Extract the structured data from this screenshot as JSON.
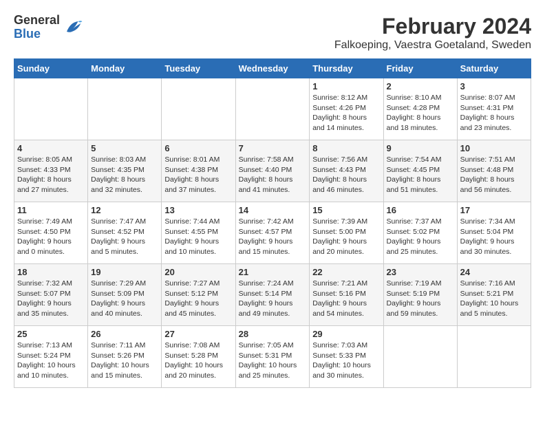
{
  "header": {
    "logo": {
      "line1": "General",
      "line2": "Blue"
    },
    "title": "February 2024",
    "subtitle": "Falkoeping, Vaestra Goetaland, Sweden"
  },
  "calendar": {
    "weekdays": [
      "Sunday",
      "Monday",
      "Tuesday",
      "Wednesday",
      "Thursday",
      "Friday",
      "Saturday"
    ],
    "weeks": [
      [
        {
          "day": "",
          "info": ""
        },
        {
          "day": "",
          "info": ""
        },
        {
          "day": "",
          "info": ""
        },
        {
          "day": "",
          "info": ""
        },
        {
          "day": "1",
          "info": "Sunrise: 8:12 AM\nSunset: 4:26 PM\nDaylight: 8 hours\nand 14 minutes."
        },
        {
          "day": "2",
          "info": "Sunrise: 8:10 AM\nSunset: 4:28 PM\nDaylight: 8 hours\nand 18 minutes."
        },
        {
          "day": "3",
          "info": "Sunrise: 8:07 AM\nSunset: 4:31 PM\nDaylight: 8 hours\nand 23 minutes."
        }
      ],
      [
        {
          "day": "4",
          "info": "Sunrise: 8:05 AM\nSunset: 4:33 PM\nDaylight: 8 hours\nand 27 minutes."
        },
        {
          "day": "5",
          "info": "Sunrise: 8:03 AM\nSunset: 4:35 PM\nDaylight: 8 hours\nand 32 minutes."
        },
        {
          "day": "6",
          "info": "Sunrise: 8:01 AM\nSunset: 4:38 PM\nDaylight: 8 hours\nand 37 minutes."
        },
        {
          "day": "7",
          "info": "Sunrise: 7:58 AM\nSunset: 4:40 PM\nDaylight: 8 hours\nand 41 minutes."
        },
        {
          "day": "8",
          "info": "Sunrise: 7:56 AM\nSunset: 4:43 PM\nDaylight: 8 hours\nand 46 minutes."
        },
        {
          "day": "9",
          "info": "Sunrise: 7:54 AM\nSunset: 4:45 PM\nDaylight: 8 hours\nand 51 minutes."
        },
        {
          "day": "10",
          "info": "Sunrise: 7:51 AM\nSunset: 4:48 PM\nDaylight: 8 hours\nand 56 minutes."
        }
      ],
      [
        {
          "day": "11",
          "info": "Sunrise: 7:49 AM\nSunset: 4:50 PM\nDaylight: 9 hours\nand 0 minutes."
        },
        {
          "day": "12",
          "info": "Sunrise: 7:47 AM\nSunset: 4:52 PM\nDaylight: 9 hours\nand 5 minutes."
        },
        {
          "day": "13",
          "info": "Sunrise: 7:44 AM\nSunset: 4:55 PM\nDaylight: 9 hours\nand 10 minutes."
        },
        {
          "day": "14",
          "info": "Sunrise: 7:42 AM\nSunset: 4:57 PM\nDaylight: 9 hours\nand 15 minutes."
        },
        {
          "day": "15",
          "info": "Sunrise: 7:39 AM\nSunset: 5:00 PM\nDaylight: 9 hours\nand 20 minutes."
        },
        {
          "day": "16",
          "info": "Sunrise: 7:37 AM\nSunset: 5:02 PM\nDaylight: 9 hours\nand 25 minutes."
        },
        {
          "day": "17",
          "info": "Sunrise: 7:34 AM\nSunset: 5:04 PM\nDaylight: 9 hours\nand 30 minutes."
        }
      ],
      [
        {
          "day": "18",
          "info": "Sunrise: 7:32 AM\nSunset: 5:07 PM\nDaylight: 9 hours\nand 35 minutes."
        },
        {
          "day": "19",
          "info": "Sunrise: 7:29 AM\nSunset: 5:09 PM\nDaylight: 9 hours\nand 40 minutes."
        },
        {
          "day": "20",
          "info": "Sunrise: 7:27 AM\nSunset: 5:12 PM\nDaylight: 9 hours\nand 45 minutes."
        },
        {
          "day": "21",
          "info": "Sunrise: 7:24 AM\nSunset: 5:14 PM\nDaylight: 9 hours\nand 49 minutes."
        },
        {
          "day": "22",
          "info": "Sunrise: 7:21 AM\nSunset: 5:16 PM\nDaylight: 9 hours\nand 54 minutes."
        },
        {
          "day": "23",
          "info": "Sunrise: 7:19 AM\nSunset: 5:19 PM\nDaylight: 9 hours\nand 59 minutes."
        },
        {
          "day": "24",
          "info": "Sunrise: 7:16 AM\nSunset: 5:21 PM\nDaylight: 10 hours\nand 5 minutes."
        }
      ],
      [
        {
          "day": "25",
          "info": "Sunrise: 7:13 AM\nSunset: 5:24 PM\nDaylight: 10 hours\nand 10 minutes."
        },
        {
          "day": "26",
          "info": "Sunrise: 7:11 AM\nSunset: 5:26 PM\nDaylight: 10 hours\nand 15 minutes."
        },
        {
          "day": "27",
          "info": "Sunrise: 7:08 AM\nSunset: 5:28 PM\nDaylight: 10 hours\nand 20 minutes."
        },
        {
          "day": "28",
          "info": "Sunrise: 7:05 AM\nSunset: 5:31 PM\nDaylight: 10 hours\nand 25 minutes."
        },
        {
          "day": "29",
          "info": "Sunrise: 7:03 AM\nSunset: 5:33 PM\nDaylight: 10 hours\nand 30 minutes."
        },
        {
          "day": "",
          "info": ""
        },
        {
          "day": "",
          "info": ""
        }
      ]
    ]
  }
}
